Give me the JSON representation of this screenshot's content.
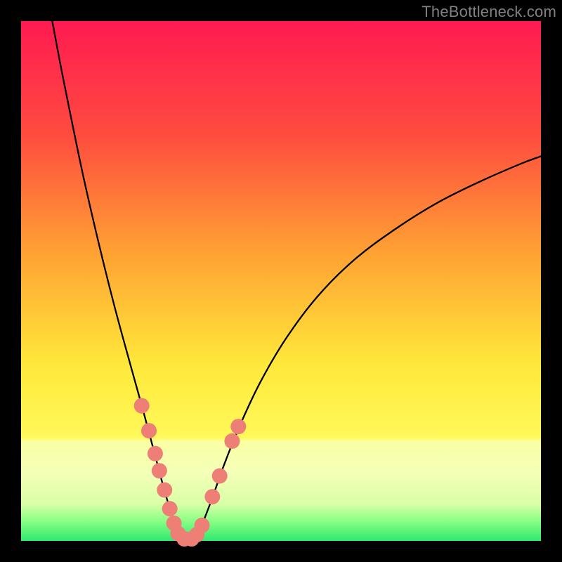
{
  "watermark": "TheBottleneck.com",
  "chart_data": {
    "type": "line",
    "title": "",
    "xlabel": "",
    "ylabel": "",
    "xlim": [
      0,
      100
    ],
    "ylim": [
      0,
      100
    ],
    "gradient_stops": [
      {
        "pct": 0,
        "color": "#ff1a51"
      },
      {
        "pct": 22,
        "color": "#ff4c3f"
      },
      {
        "pct": 45,
        "color": "#ffa333"
      },
      {
        "pct": 66,
        "color": "#ffe83a"
      },
      {
        "pct": 80,
        "color": "#fff95a"
      },
      {
        "pct": 81,
        "color": "#faffa6"
      },
      {
        "pct": 87,
        "color": "#f4ffb8"
      },
      {
        "pct": 93,
        "color": "#d8ffa6"
      },
      {
        "pct": 96,
        "color": "#8dff86"
      },
      {
        "pct": 100,
        "color": "#2fe96f"
      }
    ],
    "series": [
      {
        "name": "left-curve",
        "stroke": "#000000",
        "stroke_width": 2.3,
        "points": [
          {
            "x": 6.0,
            "y": 100.0
          },
          {
            "x": 7.5,
            "y": 92.0
          },
          {
            "x": 9.5,
            "y": 82.0
          },
          {
            "x": 12.0,
            "y": 70.0
          },
          {
            "x": 15.0,
            "y": 57.0
          },
          {
            "x": 18.0,
            "y": 45.0
          },
          {
            "x": 21.0,
            "y": 34.0
          },
          {
            "x": 23.5,
            "y": 25.0
          },
          {
            "x": 25.5,
            "y": 17.5
          },
          {
            "x": 27.5,
            "y": 10.0
          },
          {
            "x": 29.0,
            "y": 5.0
          },
          {
            "x": 30.3,
            "y": 1.5
          },
          {
            "x": 31.3,
            "y": 0.2
          }
        ]
      },
      {
        "name": "right-curve",
        "stroke": "#000000",
        "stroke_width": 2.3,
        "points": [
          {
            "x": 33.0,
            "y": 0.2
          },
          {
            "x": 34.5,
            "y": 2.5
          },
          {
            "x": 36.5,
            "y": 7.5
          },
          {
            "x": 39.0,
            "y": 14.5
          },
          {
            "x": 42.0,
            "y": 22.0
          },
          {
            "x": 46.0,
            "y": 30.5
          },
          {
            "x": 51.0,
            "y": 39.0
          },
          {
            "x": 57.0,
            "y": 47.0
          },
          {
            "x": 64.0,
            "y": 54.0
          },
          {
            "x": 72.0,
            "y": 60.0
          },
          {
            "x": 80.0,
            "y": 65.0
          },
          {
            "x": 88.0,
            "y": 69.0
          },
          {
            "x": 96.0,
            "y": 72.5
          },
          {
            "x": 100.0,
            "y": 74.0
          }
        ]
      }
    ],
    "scatter": {
      "name": "markers",
      "color": "#ee7f76",
      "radius": 11,
      "points": [
        {
          "x": 23.2,
          "y": 26.0
        },
        {
          "x": 24.6,
          "y": 21.2
        },
        {
          "x": 25.8,
          "y": 16.8
        },
        {
          "x": 26.6,
          "y": 13.5
        },
        {
          "x": 27.6,
          "y": 9.8
        },
        {
          "x": 28.6,
          "y": 6.2
        },
        {
          "x": 29.4,
          "y": 3.4
        },
        {
          "x": 30.2,
          "y": 1.4
        },
        {
          "x": 31.4,
          "y": 0.4
        },
        {
          "x": 32.8,
          "y": 0.4
        },
        {
          "x": 33.8,
          "y": 1.2
        },
        {
          "x": 34.8,
          "y": 3.0
        },
        {
          "x": 36.8,
          "y": 8.5
        },
        {
          "x": 38.2,
          "y": 12.5
        },
        {
          "x": 40.6,
          "y": 19.2
        },
        {
          "x": 41.8,
          "y": 22.0
        }
      ]
    }
  }
}
